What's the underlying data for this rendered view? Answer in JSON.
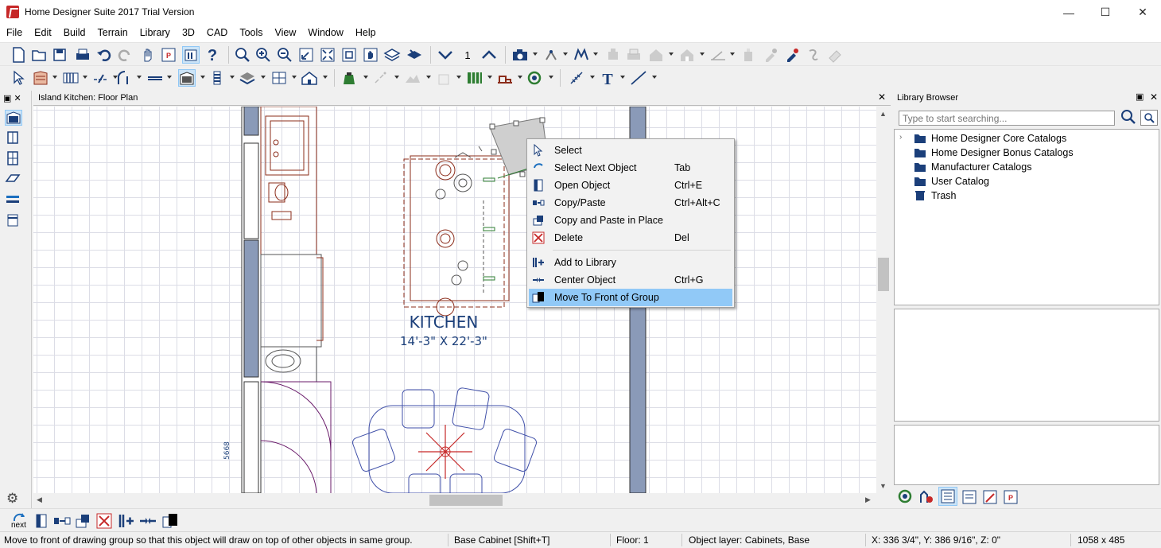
{
  "window": {
    "title": "Home Designer Suite 2017 Trial Version",
    "minimize_glyph": "—",
    "maximize_glyph": "☐",
    "close_glyph": "✕"
  },
  "menu": [
    "File",
    "Edit",
    "Build",
    "Terrain",
    "Library",
    "3D",
    "CAD",
    "Tools",
    "View",
    "Window",
    "Help"
  ],
  "toolbar": {
    "floor_number": "1"
  },
  "plan_view": {
    "title": "Island Kitchen: Floor Plan",
    "room_name": "KITCHEN",
    "room_size": "14'-3\" X 22'-3\"",
    "dimension_label": "5668",
    "next_label": "next",
    "panel_close_glyph": "✕"
  },
  "library_browser": {
    "title": "Library Browser",
    "search_placeholder": "Type to start searching...",
    "close_glyph": "✕",
    "items": [
      {
        "label": "Home Designer Core Catalogs",
        "expandable": true
      },
      {
        "label": "Home Designer Bonus Catalogs",
        "expandable": false
      },
      {
        "label": "Manufacturer Catalogs",
        "expandable": false
      },
      {
        "label": "User Catalog",
        "expandable": false
      },
      {
        "label": "Trash",
        "expandable": false
      }
    ]
  },
  "context_menu": {
    "items": [
      {
        "label": "Select",
        "shortcut": "",
        "icon": "pointer-icon"
      },
      {
        "label": "Select Next Object",
        "shortcut": "Tab",
        "icon": "select-next-icon"
      },
      {
        "label": "Open Object",
        "shortcut": "Ctrl+E",
        "icon": "open-object-icon"
      },
      {
        "label": "Copy/Paste",
        "shortcut": "Ctrl+Alt+C",
        "icon": "copy-paste-icon"
      },
      {
        "label": "Copy and Paste in Place",
        "shortcut": "",
        "icon": "copy-paste-in-place-icon"
      },
      {
        "label": "Delete",
        "shortcut": "Del",
        "icon": "delete-icon"
      },
      {
        "label": "Add to Library",
        "shortcut": "",
        "icon": "add-to-library-icon"
      },
      {
        "label": "Center Object",
        "shortcut": "Ctrl+G",
        "icon": "center-object-icon"
      },
      {
        "label": "Move To Front of Group",
        "shortcut": "",
        "icon": "move-to-front-icon",
        "highlighted": true
      }
    ]
  },
  "bottom_toolbar": {
    "next_label": "next"
  },
  "status_bar": {
    "message": "Move to front of drawing group so that this object will draw on top of other objects in same group.",
    "tool": "Base Cabinet [Shift+T]",
    "floor": "Floor: 1",
    "layer": "Object layer: Cabinets,  Base",
    "coords": "X: 336 3/4\", Y: 386 9/16\", Z: 0\"",
    "size": "1058 x 485"
  }
}
